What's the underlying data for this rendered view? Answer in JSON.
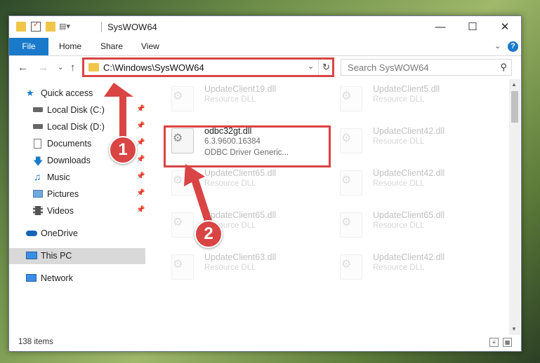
{
  "window": {
    "title": "SysWOW64"
  },
  "ribbon": {
    "file": "File",
    "home": "Home",
    "share": "Share",
    "view": "View",
    "help": "?"
  },
  "address": {
    "path": "C:\\Windows\\SysWOW64"
  },
  "search": {
    "placeholder": "Search SysWOW64"
  },
  "sidebar": {
    "items": [
      {
        "label": "Quick access",
        "icon": "star-icon"
      },
      {
        "label": "Local Disk (C:)",
        "icon": "drive-icon"
      },
      {
        "label": "Local Disk (D:)",
        "icon": "drive-icon"
      },
      {
        "label": "Documents",
        "icon": "documents-icon"
      },
      {
        "label": "Downloads",
        "icon": "download-icon"
      },
      {
        "label": "Music",
        "icon": "music-icon"
      },
      {
        "label": "Pictures",
        "icon": "pictures-icon"
      },
      {
        "label": "Videos",
        "icon": "videos-icon"
      },
      {
        "label": "OneDrive",
        "icon": "cloud-icon"
      },
      {
        "label": "This PC",
        "icon": "computer-icon"
      },
      {
        "label": "Network",
        "icon": "network-icon"
      }
    ]
  },
  "files": {
    "left": [
      {
        "name": "UpdateClient19.dll",
        "type": "Resource DLL"
      },
      {
        "name": "odbc32gt.dll",
        "version": "6.3.9600.16384",
        "type": "ODBC Driver Generic..."
      },
      {
        "name": "UpdateClient65.dll",
        "type": "Resource DLL"
      },
      {
        "name": "UpdateClient65.dll",
        "type": "Resource DLL"
      },
      {
        "name": "UpdateClient63.dll",
        "type": "Resource DLL"
      }
    ],
    "right": [
      {
        "name": "UpdateClient5.dll",
        "type": "Resource DLL"
      },
      {
        "name": "UpdateClient42.dll",
        "type": "Resource DLL"
      },
      {
        "name": "UpdateClient42.dll",
        "type": "Resource DLL"
      },
      {
        "name": "UpdateClient65.dll",
        "type": "Resource DLL"
      },
      {
        "name": "UpdateClient42.dll",
        "type": "Resource DLL"
      }
    ]
  },
  "status": {
    "count": "138 items"
  },
  "annotations": {
    "step1": "1",
    "step2": "2",
    "color": "#d94444"
  }
}
